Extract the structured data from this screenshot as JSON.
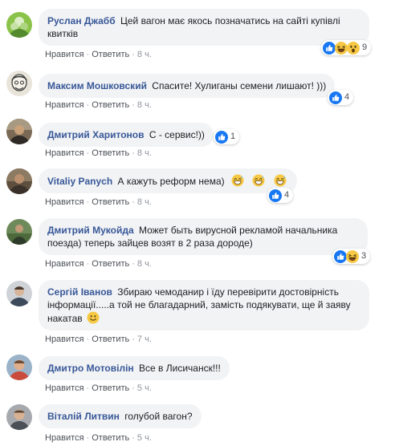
{
  "actions": {
    "like_label": "Нравится",
    "reply_label": "Ответить",
    "separator": "·"
  },
  "comments": [
    {
      "author": "Руслан Джабб",
      "text": "Цей вагон має якось позначатись на сайті купівлі квитків",
      "time": "8 ч.",
      "reactions": [
        "like-icon",
        "haha-icon",
        "wow-icon"
      ],
      "reaction_count": "9"
    },
    {
      "author": "Максим Мошковский",
      "text": "Спасите! Хулиганы семени лишают! )))",
      "time": "8 ч.",
      "reactions": [
        "like-icon"
      ],
      "reaction_count": "4"
    },
    {
      "author": "Дмитрий Харитонов",
      "text": "С - сервис!))",
      "time": "8 ч.",
      "reactions": [
        "like-icon"
      ],
      "reaction_count": "1"
    },
    {
      "author": "Vitaliy Panych",
      "text": "А кажуть реформ нема)",
      "time": "8 ч.",
      "emoji": [
        "grinning-sweat-emoji",
        "grinning-sweat-emoji",
        "grinning-sweat-emoji"
      ],
      "reactions": [
        "like-icon"
      ],
      "reaction_count": "4"
    },
    {
      "author": "Дмитрий Мукойда",
      "text": "Может быть вирусной рекламой начальника поезда) теперь зайцев возят в 2 раза дороде)",
      "time": "8 ч.",
      "reactions": [
        "like-icon",
        "haha-icon"
      ],
      "reaction_count": "3"
    },
    {
      "author": "Сергій Іванов",
      "text": "Збираю чемоданир і їду перевірити достовірність інформації.....а той не благадарний, замість подякувати, ще й заяву накатав",
      "time": "7 ч.",
      "emoji": [
        "smile-emoji"
      ]
    },
    {
      "author": "Дмитро Мотовілін",
      "text": "Все в Лисичанск!!!",
      "time": "5 ч."
    },
    {
      "author": "Віталій Литвин",
      "text": "голубой вагон?",
      "time": "5 ч."
    }
  ],
  "colors": {
    "author": "#385898",
    "bubble": "#f2f3f5",
    "meta": "#90949c",
    "like_blue": "#1877f2",
    "emoji_yellow": "#f7c843"
  }
}
